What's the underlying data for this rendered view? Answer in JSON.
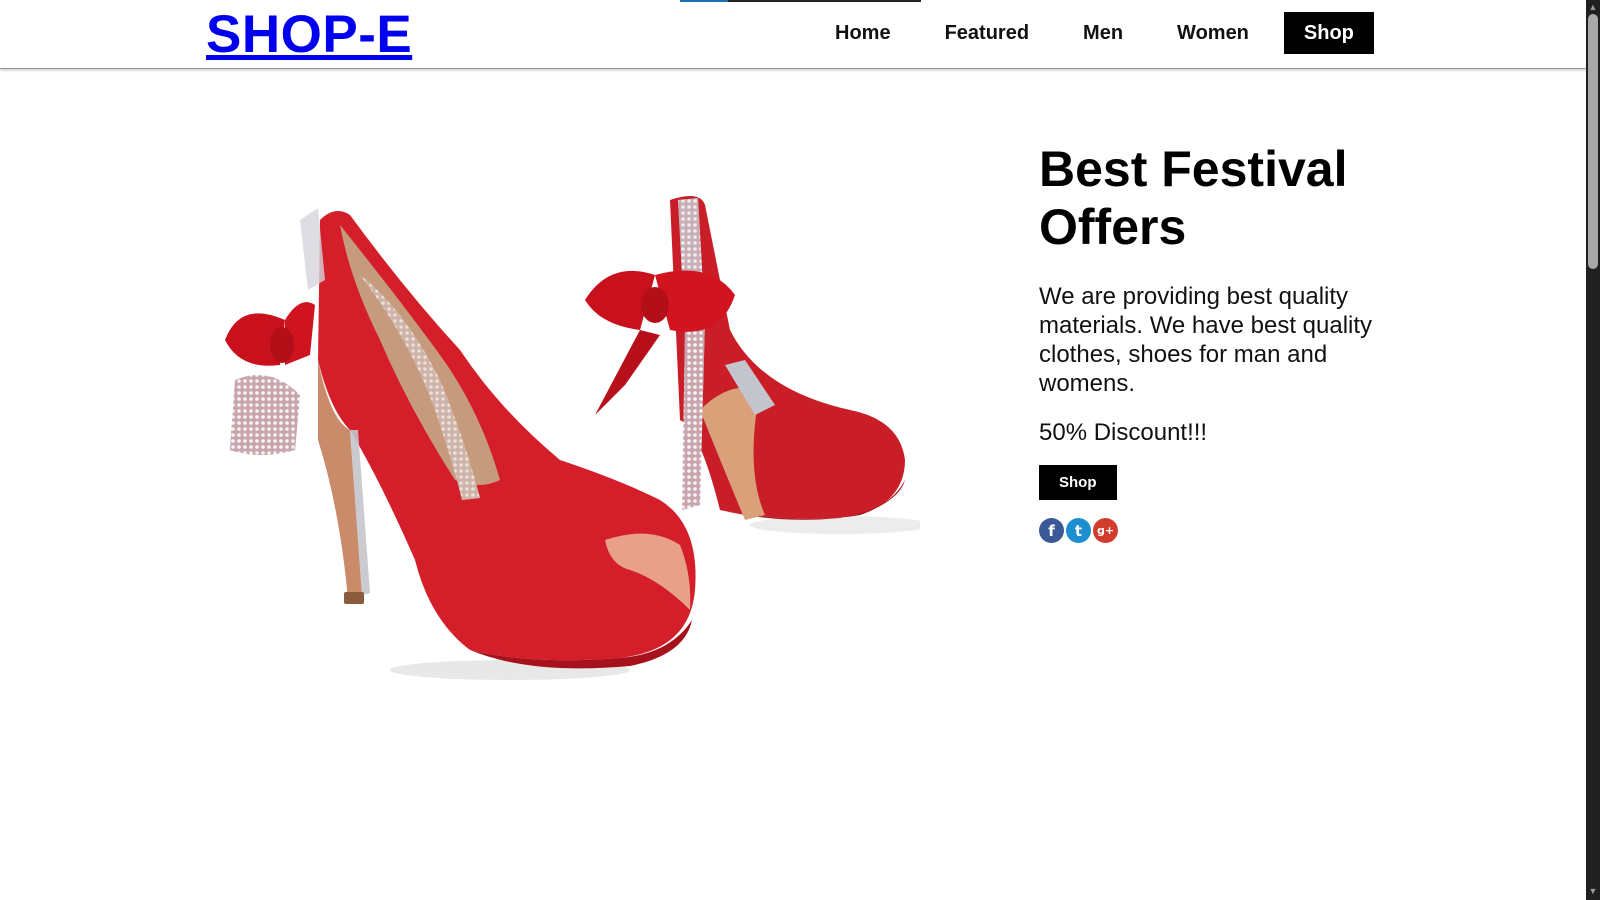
{
  "header": {
    "logo": "SHOP-E",
    "nav": [
      {
        "label": "Home"
      },
      {
        "label": "Featured"
      },
      {
        "label": "Men"
      },
      {
        "label": "Women"
      },
      {
        "label": "Shop"
      }
    ]
  },
  "hero": {
    "title": "Best Festival Offers",
    "description": "We are providing best quality materials. We have best quality clothes, shoes for man and womens.",
    "discount": "50% Discount!!!",
    "button_label": "Shop",
    "social": [
      {
        "name": "facebook-icon",
        "glyph": "f"
      },
      {
        "name": "twitter-icon",
        "glyph": "t"
      },
      {
        "name": "google-plus-icon",
        "glyph": "g+"
      }
    ]
  },
  "colors": {
    "logo_link": "#0000ee",
    "nav_active_bg": "#000000",
    "shoe_red": "#d21e2b",
    "facebook": "#3b5998",
    "twitter": "#1d8fd1",
    "google_plus": "#d23c2c"
  }
}
